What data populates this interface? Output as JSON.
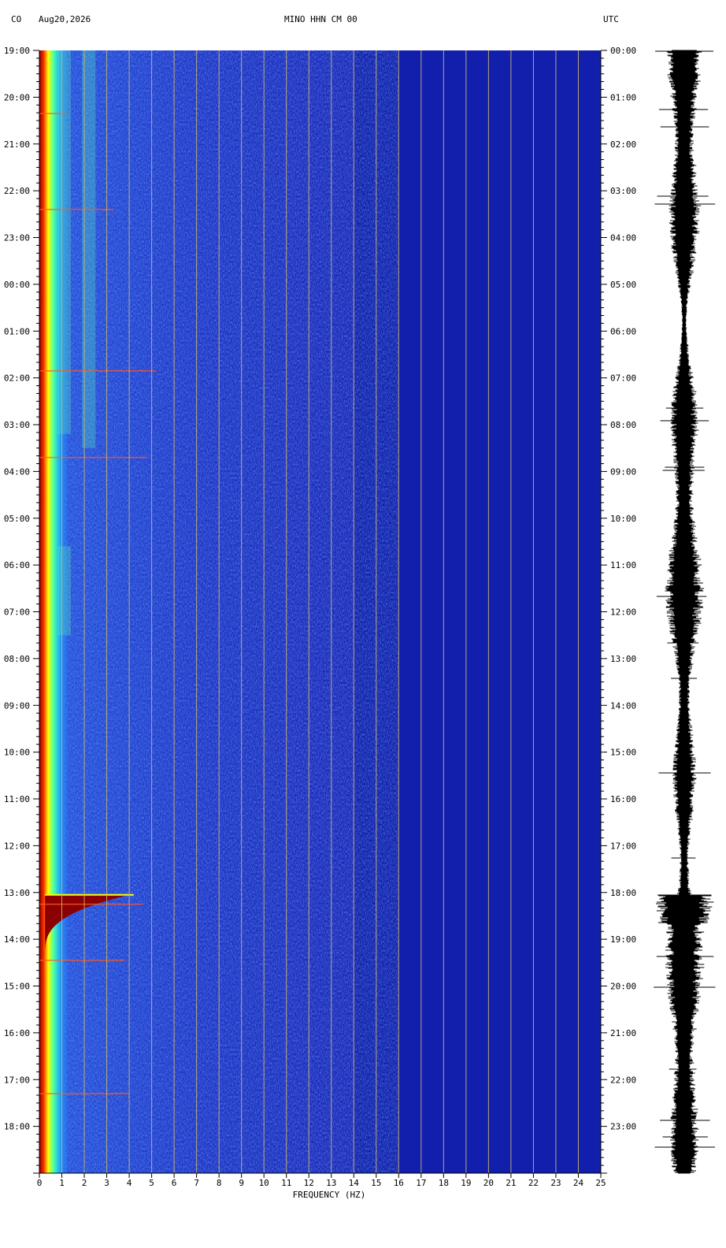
{
  "header": {
    "network": "CO",
    "date": "Aug20,2026",
    "station": "MINO HHN CM 00",
    "timezone": "UTC"
  },
  "chart_data": {
    "type": "heatmap",
    "title": "MINO HHN CM 00",
    "xlabel": "FREQUENCY (HZ)",
    "xlim": [
      0,
      25
    ],
    "x_ticks": [
      0,
      1,
      2,
      3,
      4,
      5,
      6,
      7,
      8,
      9,
      10,
      11,
      12,
      13,
      14,
      15,
      16,
      17,
      18,
      19,
      20,
      21,
      22,
      23,
      24,
      25
    ],
    "y_ticks_left": [
      "19:00",
      "20:00",
      "21:00",
      "22:00",
      "23:00",
      "00:00",
      "01:00",
      "02:00",
      "03:00",
      "04:00",
      "05:00",
      "06:00",
      "07:00",
      "08:00",
      "09:00",
      "10:00",
      "11:00",
      "12:00",
      "13:00",
      "14:00",
      "15:00",
      "16:00",
      "17:00",
      "18:00"
    ],
    "y_ticks_right": [
      "00:00",
      "01:00",
      "02:00",
      "03:00",
      "04:00",
      "05:00",
      "06:00",
      "07:00",
      "08:00",
      "09:00",
      "10:00",
      "11:00",
      "12:00",
      "13:00",
      "14:00",
      "15:00",
      "16:00",
      "17:00",
      "18:00",
      "19:00",
      "20:00",
      "21:00",
      "22:00",
      "23:00"
    ],
    "hours_span": 24,
    "event_hour": 18.05,
    "colors": {
      "background": "#1a26b8",
      "grid": "#c8b470",
      "low": "#0f1ea8",
      "mid": "#2a7aff",
      "high": "#ffff00",
      "peak": "#8b0000",
      "trace": "#000000"
    },
    "grid": true
  }
}
